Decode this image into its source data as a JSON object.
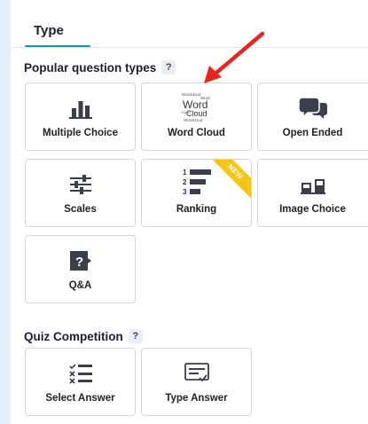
{
  "tab": {
    "label": "Type"
  },
  "sections": {
    "popular": {
      "title": "Popular question types",
      "help": "?"
    },
    "quiz": {
      "title": "Quiz Competition",
      "help": "?"
    }
  },
  "cards": {
    "multiple_choice": {
      "label": "Multiple Choice",
      "icon": "bar-chart-icon"
    },
    "word_cloud": {
      "label": "Word Cloud",
      "icon": "word-cloud-icon",
      "icon_words": [
        "Wordcloud",
        "Word",
        "Word",
        "Cloud",
        "Cloud",
        "Wordcloud"
      ]
    },
    "open_ended": {
      "label": "Open Ended",
      "icon": "speech-bubbles-icon"
    },
    "scales": {
      "label": "Scales",
      "icon": "sliders-icon"
    },
    "ranking": {
      "label": "Ranking",
      "icon": "ranking-icon",
      "badge": "NEW",
      "numbers": [
        "1",
        "2",
        "3"
      ]
    },
    "image_choice": {
      "label": "Image Choice",
      "icon": "image-choice-icon"
    },
    "qa": {
      "label": "Q&A",
      "icon": "question-box-icon",
      "glyph": "?"
    },
    "select_answer": {
      "label": "Select Answer",
      "icon": "checklist-icon"
    },
    "type_answer": {
      "label": "Type Answer",
      "icon": "type-answer-icon"
    }
  },
  "colors": {
    "accent": "#1a8fc4",
    "icon": "#3a3f4b",
    "badge": "#f5c518",
    "arrow": "#e8261f",
    "background": "#e3eef7"
  }
}
